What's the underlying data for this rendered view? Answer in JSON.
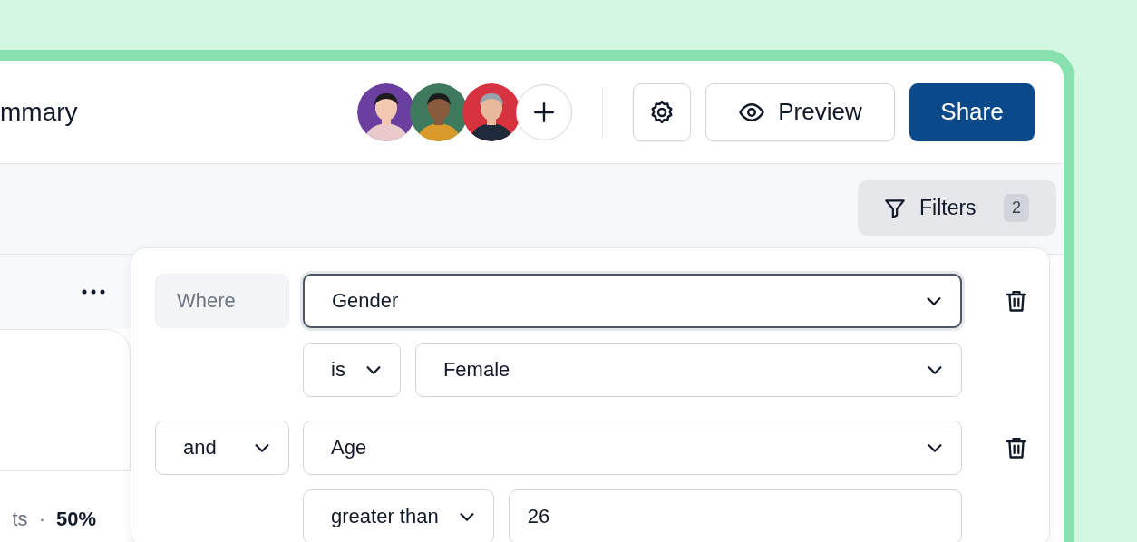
{
  "header": {
    "title": "mmary",
    "preview_button": "Preview",
    "share_button": "Share"
  },
  "toolbar": {
    "filters_button": "Filters",
    "filters_count": "2"
  },
  "summary": {
    "label": "ts",
    "separator": "·",
    "value": "50%"
  },
  "filters": [
    {
      "connector": {
        "kind": "label",
        "text": "Where"
      },
      "field": "Gender",
      "focused": true,
      "operator": "is",
      "value": {
        "kind": "select",
        "text": "Female"
      }
    },
    {
      "connector": {
        "kind": "select",
        "text": "and"
      },
      "field": "Age",
      "focused": false,
      "operator": "greater than",
      "value": {
        "kind": "input",
        "text": "26"
      }
    }
  ]
}
